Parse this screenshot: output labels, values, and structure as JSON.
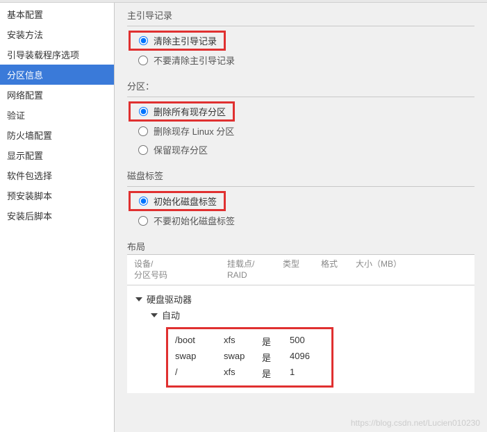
{
  "sidebar": {
    "items": [
      {
        "label": "基本配置"
      },
      {
        "label": "安装方法"
      },
      {
        "label": "引导装载程序选项"
      },
      {
        "label": "分区信息"
      },
      {
        "label": "网络配置"
      },
      {
        "label": "验证"
      },
      {
        "label": "防火墙配置"
      },
      {
        "label": "显示配置"
      },
      {
        "label": "软件包选择"
      },
      {
        "label": "预安装脚本"
      },
      {
        "label": "安装后脚本"
      }
    ],
    "active_index": 3
  },
  "sections": {
    "mbr": {
      "title": "主引导记录",
      "opt_clear": "清除主引导记录",
      "opt_keep": "不要清除主引导记录"
    },
    "partition": {
      "title": "分区：",
      "opt_delete_all": "删除所有现存分区",
      "opt_delete_linux": "删除现存 Linux 分区",
      "opt_keep": "保留现存分区"
    },
    "disklabel": {
      "title": "磁盘标签",
      "opt_init": "初始化磁盘标签",
      "opt_keep": "不要初始化磁盘标签"
    }
  },
  "layout": {
    "title": "布局",
    "headers": {
      "device": "设备/\n分区号码",
      "mount": "挂载点/\nRAID",
      "type": "类型",
      "format": "格式",
      "size": "大小（MB）"
    },
    "tree": {
      "root": "硬盘驱动器",
      "child": "自动"
    },
    "rows": [
      {
        "mount": "/boot",
        "type": "xfs",
        "format": "是",
        "size": "500"
      },
      {
        "mount": "swap",
        "type": "swap",
        "format": "是",
        "size": "4096"
      },
      {
        "mount": "/",
        "type": "xfs",
        "format": "是",
        "size": "1"
      }
    ]
  },
  "watermark": "https://blog.csdn.net/Lucien010230"
}
